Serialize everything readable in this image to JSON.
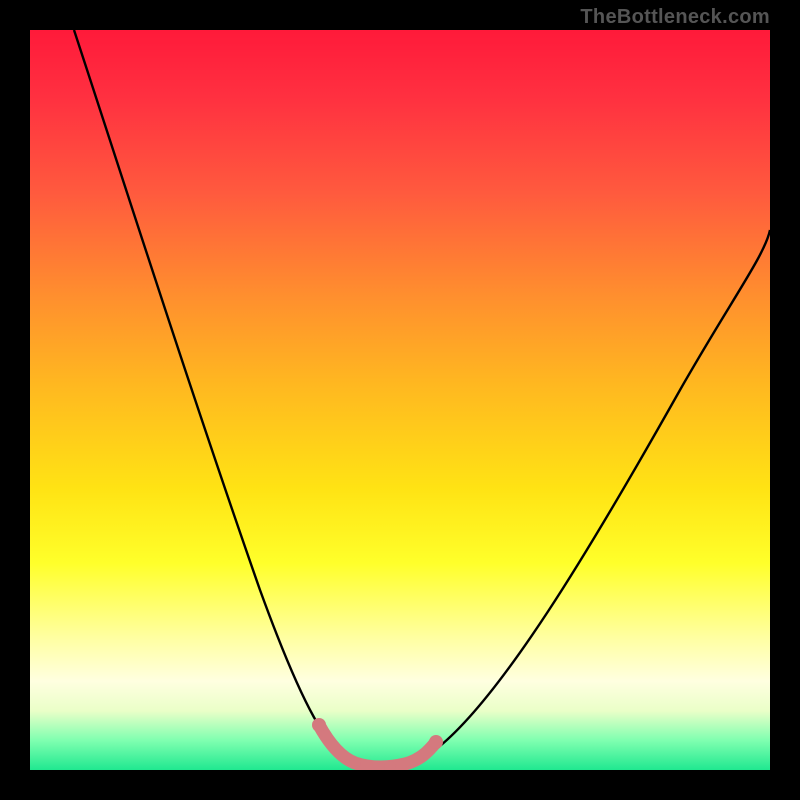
{
  "attribution": "TheBottleneck.com",
  "colors": {
    "gradient_top": "#ff1a3a",
    "gradient_mid": "#ffe314",
    "gradient_bottom": "#20e890",
    "frame": "#000000",
    "curve": "#000000",
    "highlight": "#d4797e"
  },
  "chart_data": {
    "type": "line",
    "title": "",
    "xlabel": "",
    "ylabel": "",
    "xlim": [
      0,
      100
    ],
    "ylim": [
      0,
      100
    ],
    "grid": false,
    "legend": false,
    "series": [
      {
        "name": "bottleneck-curve",
        "x": [
          6,
          10,
          14,
          18,
          22,
          26,
          30,
          34,
          38,
          40,
          42,
          44,
          46,
          50,
          54,
          58,
          62,
          66,
          70,
          75,
          80,
          85,
          90,
          95,
          100
        ],
        "y": [
          100,
          87,
          75,
          63,
          52,
          41,
          31,
          22,
          13,
          9,
          5,
          2,
          1,
          1,
          2,
          5,
          10,
          16,
          22,
          29,
          37,
          44,
          51,
          57,
          62
        ]
      },
      {
        "name": "min-highlight",
        "x": [
          40,
          42,
          44,
          46,
          48,
          50,
          52,
          54
        ],
        "y": [
          9,
          5,
          2,
          1,
          1,
          1,
          2,
          5
        ]
      }
    ],
    "annotations": []
  }
}
